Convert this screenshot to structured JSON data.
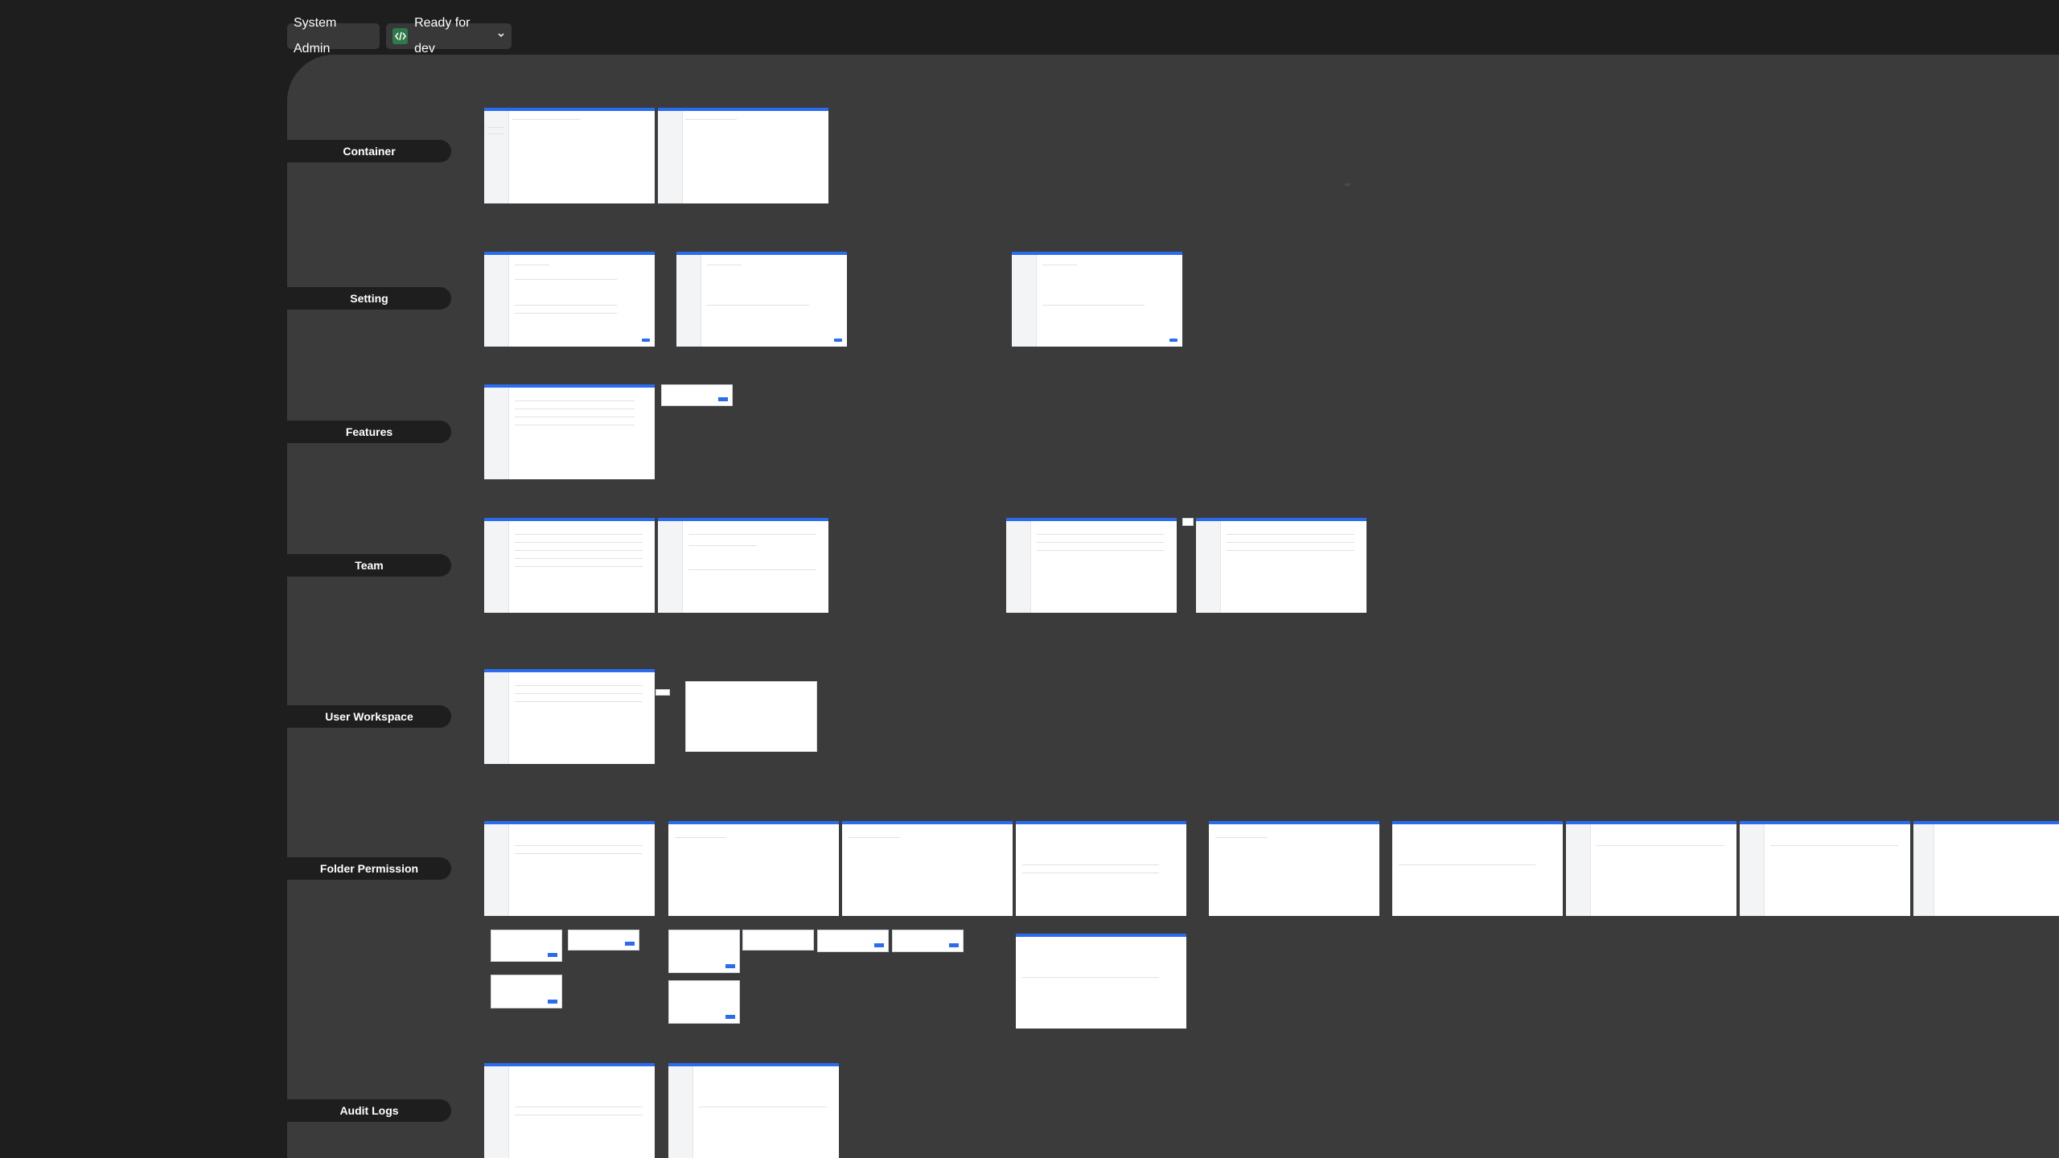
{
  "header": {
    "role_label": "System Admin",
    "status_label": "Ready for dev",
    "status_icon": "code-icon",
    "status_color": "#2f7a4a",
    "dropdown_icon": "chevron-down-icon"
  },
  "colors": {
    "canvas": "#3b3b3b",
    "chrome": "#1e1e1e",
    "frame_accent": "#2a6cf0"
  },
  "sections": [
    {
      "label": "Container"
    },
    {
      "label": "Setting"
    },
    {
      "label": "Features"
    },
    {
      "label": "Team"
    },
    {
      "label": "User Workspace"
    },
    {
      "label": "Folder Permission"
    },
    {
      "label": "Audit Logs"
    }
  ]
}
